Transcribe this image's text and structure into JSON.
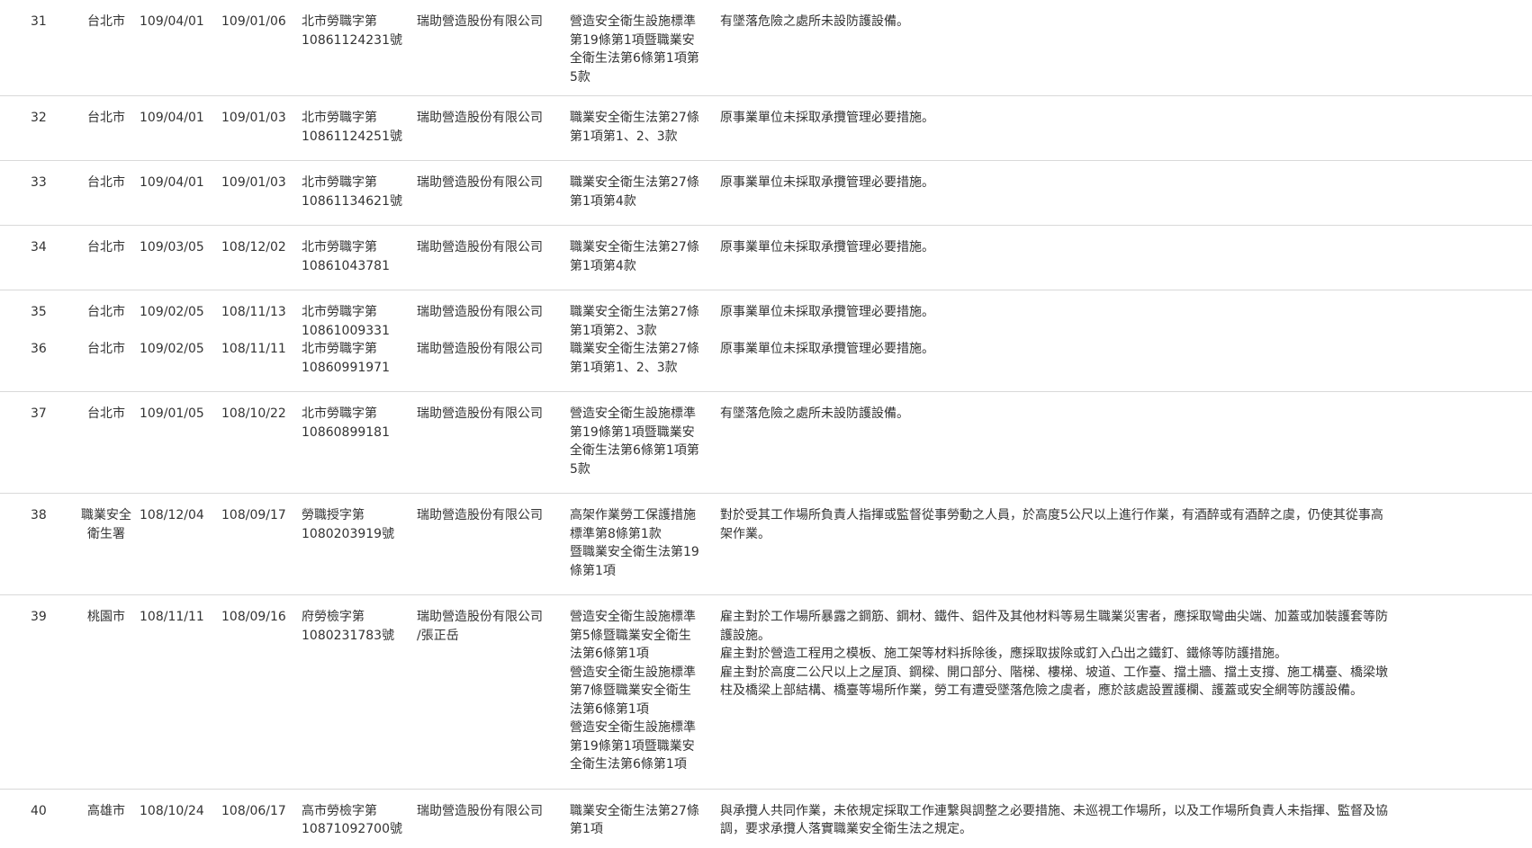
{
  "rows": [
    {
      "no": "31",
      "city": "台北市",
      "date1": "109/04/01",
      "date2": "109/01/06",
      "doc": [
        "北市勞職字第",
        "10861124231號"
      ],
      "company": [
        "瑞助營造股份有限公司"
      ],
      "law": [
        "營造安全衛生設施標準",
        "第19條第1項暨職業安",
        "全衛生法第6條第1項第",
        "5款"
      ],
      "desc": [
        "有墜落危險之處所未設防護設備。"
      ]
    },
    {
      "no": "32",
      "city": "台北市",
      "date1": "109/04/01",
      "date2": "109/01/03",
      "doc": [
        "北市勞職字第",
        "10861124251號"
      ],
      "company": [
        "瑞助營造股份有限公司"
      ],
      "law": [
        "職業安全衛生法第27條",
        "第1項第1、2、3款"
      ],
      "desc": [
        "原事業單位未採取承攬管理必要措施。"
      ]
    },
    {
      "no": "33",
      "city": "台北市",
      "date1": "109/04/01",
      "date2": "109/01/03",
      "doc": [
        "北市勞職字第",
        "10861134621號"
      ],
      "company": [
        "瑞助營造股份有限公司"
      ],
      "law": [
        "職業安全衛生法第27條",
        "第1項第4款"
      ],
      "desc": [
        "原事業單位未採取承攬管理必要措施。"
      ]
    },
    {
      "no": "34",
      "city": "台北市",
      "date1": "109/03/05",
      "date2": "108/12/02",
      "doc": [
        "北市勞職字第",
        "10861043781"
      ],
      "company": [
        "瑞助營造股份有限公司"
      ],
      "law": [
        "職業安全衛生法第27條",
        "第1項第4款"
      ],
      "desc": [
        "原事業單位未採取承攬管理必要措施。"
      ]
    },
    {
      "no": "35",
      "city": "台北市",
      "date1": "109/02/05",
      "date2": "108/11/13",
      "doc": [
        "北市勞職字第",
        "10861009331"
      ],
      "company": [
        "瑞助營造股份有限公司"
      ],
      "law": [
        "職業安全衛生法第27條",
        "第1項第2、3款"
      ],
      "desc": [
        "原事業單位未採取承攬管理必要措施。"
      ]
    },
    {
      "no": "36",
      "city": "台北市",
      "date1": "109/02/05",
      "date2": "108/11/11",
      "doc": [
        "北市勞職字第",
        "10860991971"
      ],
      "company": [
        "瑞助營造股份有限公司"
      ],
      "law": [
        "職業安全衛生法第27條",
        "第1項第1、2、3款"
      ],
      "desc": [
        "原事業單位未採取承攬管理必要措施。"
      ]
    },
    {
      "no": "37",
      "city": "台北市",
      "date1": "109/01/05",
      "date2": "108/10/22",
      "doc": [
        "北市勞職字第",
        "10860899181"
      ],
      "company": [
        "瑞助營造股份有限公司"
      ],
      "law": [
        "營造安全衛生設施標準",
        "第19條第1項暨職業安",
        "全衛生法第6條第1項第",
        "5款"
      ],
      "desc": [
        "有墜落危險之處所未設防護設備。"
      ]
    },
    {
      "no": "38",
      "city": [
        "職業安全",
        "衛生署"
      ],
      "date1": "108/12/04",
      "date2": "108/09/17",
      "doc": [
        "勞職授字第",
        "1080203919號"
      ],
      "company": [
        "瑞助營造股份有限公司"
      ],
      "law": [
        "高架作業勞工保護措施",
        "標準第8條第1款",
        "暨職業安全衛生法第19",
        "條第1項"
      ],
      "desc": [
        "對於受其工作場所負責人指揮或監督從事勞動之人員，於高度5公尺以上進行作業，有酒醉或有酒醉之虞，仍使其從事高",
        "架作業。"
      ]
    },
    {
      "no": "39",
      "city": "桃園市",
      "date1": "108/11/11",
      "date2": "108/09/16",
      "doc": [
        "府勞檢字第",
        "1080231783號"
      ],
      "company": [
        "瑞助營造股份有限公司",
        "/張正岳"
      ],
      "law": [
        "營造安全衛生設施標準",
        "第5條暨職業安全衛生",
        "法第6條第1項",
        "營造安全衛生設施標準",
        "第7條暨職業安全衛生",
        "法第6條第1項",
        "營造安全衛生設施標準",
        "第19條第1項暨職業安",
        "全衛生法第6條第1項"
      ],
      "desc": [
        "雇主對於工作場所暴露之鋼筋、鋼材、鐵件、鋁件及其他材料等易生職業災害者，應採取彎曲尖端、加蓋或加裝護套等防",
        "護設施。",
        "雇主對於營造工程用之模板、施工架等材料拆除後，應採取拔除或釘入凸出之鐵釘、鐵條等防護措施。",
        "雇主對於高度二公尺以上之屋頂、鋼樑、開口部分、階梯、樓梯、坡道、工作臺、擋土牆、擋土支撐、施工構臺、橋梁墩",
        "柱及橋梁上部結構、橋臺等場所作業，勞工有遭受墜落危險之虞者，應於該處設置護欄、護蓋或安全網等防護設備。"
      ]
    },
    {
      "no": "40",
      "city": "高雄市",
      "date1": "108/10/24",
      "date2": "108/06/17",
      "doc": [
        "高市勞檢字第",
        "10871092700號"
      ],
      "company": [
        "瑞助營造股份有限公司"
      ],
      "law": [
        "職業安全衛生法第27條",
        "第1項"
      ],
      "desc": [
        "與承攬人共同作業，未依規定採取工作連繫與調整之必要措施、未巡視工作場所，以及工作場所負責人未指揮、監督及協",
        "調，要求承攬人落實職業安全衛生法之規定。"
      ]
    }
  ]
}
